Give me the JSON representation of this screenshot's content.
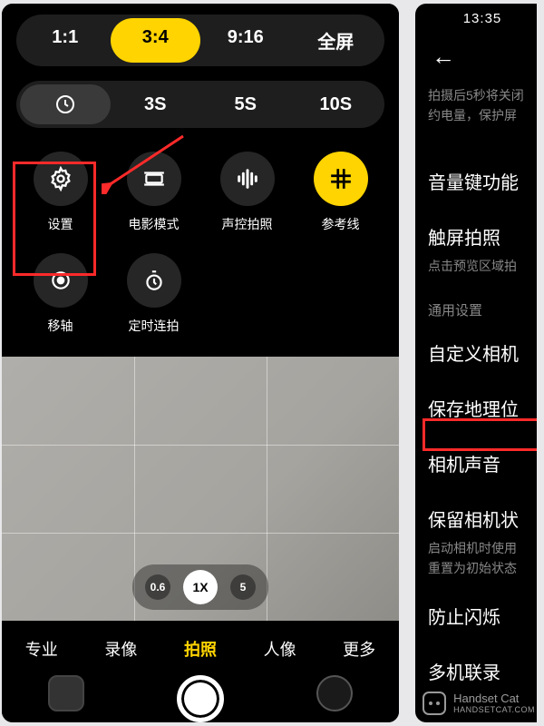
{
  "left": {
    "aspect_ratios": [
      "1:1",
      "3:4",
      "9:16",
      "全屏"
    ],
    "aspect_active_index": 1,
    "timers": [
      "clock-icon",
      "3S",
      "5S",
      "10S"
    ],
    "timer_active_index": 0,
    "options": [
      {
        "icon": "gear-icon",
        "label": "设置"
      },
      {
        "icon": "cinema-icon",
        "label": "电影模式"
      },
      {
        "icon": "sound-icon",
        "label": "声控拍照"
      },
      {
        "icon": "grid-icon",
        "label": "参考线",
        "highlight": true
      },
      {
        "icon": "tilt-icon",
        "label": "移轴"
      },
      {
        "icon": "timer-burst-icon",
        "label": "定时连拍"
      }
    ],
    "zoom": [
      "0.6",
      "1X",
      "5"
    ],
    "zoom_active_index": 1,
    "modes": [
      "专业",
      "录像",
      "拍照",
      "人像",
      "更多"
    ],
    "mode_active_index": 2,
    "accent_color": "#ffd400",
    "annotation_color": "#ff2a2a"
  },
  "right": {
    "time": "13:35",
    "faded_line1": "拍摄后5秒将关闭",
    "faded_line2": "约电量，保护屏",
    "items": {
      "volume": "音量键功能",
      "touch": "触屏拍照",
      "touch_sub": "点击预览区域拍",
      "section": "通用设置",
      "custom": "自定义相机",
      "location": "保存地理位",
      "sound": "相机声音",
      "keep": "保留相机状",
      "keep_sub1": "启动相机时使用",
      "keep_sub2": "重置为初始状态",
      "flicker": "防止闪烁",
      "multi": "多机联录"
    }
  },
  "watermark": {
    "line1": "Handset Cat",
    "line2": "HANDSETCAT.COM"
  }
}
